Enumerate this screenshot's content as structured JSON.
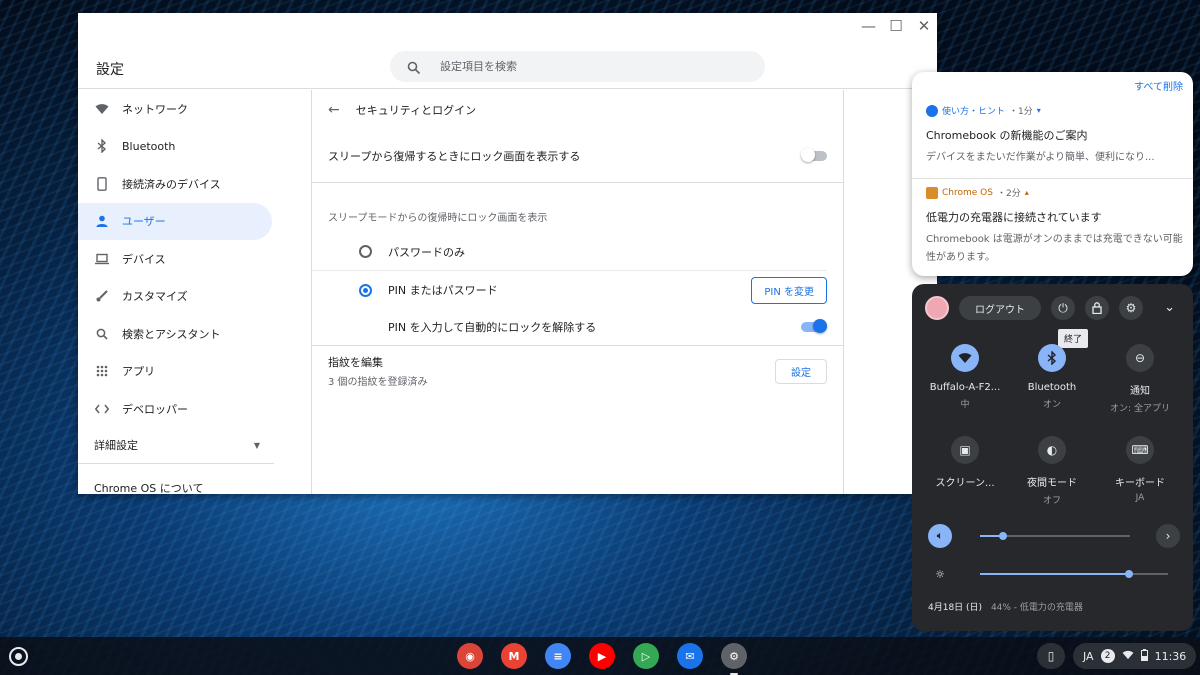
{
  "settings": {
    "app_title": "設定",
    "search_placeholder": "設定項目を検索",
    "window_controls": {
      "minimize_icon": "minimize-icon",
      "maximize_icon": "maximize-icon",
      "close_icon": "close-icon"
    },
    "sidebar": {
      "items": [
        {
          "label": "ネットワーク",
          "icon": "wifi-icon"
        },
        {
          "label": "Bluetooth",
          "icon": "bluetooth-icon"
        },
        {
          "label": "接続済みのデバイス",
          "icon": "phone-icon"
        },
        {
          "label": "ユーザー",
          "icon": "person-icon",
          "active": true
        },
        {
          "label": "デバイス",
          "icon": "laptop-icon"
        },
        {
          "label": "カスタマイズ",
          "icon": "brush-icon"
        },
        {
          "label": "検索とアシスタント",
          "icon": "search-icon"
        },
        {
          "label": "アプリ",
          "icon": "apps-grid-icon"
        },
        {
          "label": "デベロッパー",
          "icon": "code-icon"
        }
      ],
      "advanced_label": "詳細設定",
      "about_label": "Chrome OS について"
    },
    "page": {
      "title": "セキュリティとログイン",
      "sleep_lock_label": "スリープから復帰するときにロック画面を表示する",
      "sleep_lock_enabled": false,
      "lock_section_label": "スリープモードからの復帰時にロック画面を表示",
      "option_password": "パスワードのみ",
      "option_pin": "PIN またはパスワード",
      "selected_option": "PIN またはパスワード",
      "change_pin_button": "PIN を変更",
      "auto_unlock_label": "PIN を入力して自動的にロックを解除する",
      "auto_unlock_enabled": true,
      "fingerprint_title": "指紋を編集",
      "fingerprint_sub": "3 個の指紋を登録済み",
      "fingerprint_button": "設定"
    }
  },
  "notifications": {
    "clear_all": "すべて削除",
    "items": [
      {
        "app": "使い方・ヒント",
        "time": "・1分",
        "title": "Chromebook の新機能のご案内",
        "body": "デバイスをまたいだ作業がより簡単、便利になり..."
      },
      {
        "app": "Chrome OS",
        "time": "・2分",
        "title": "低電力の充電器に接続されています",
        "body": "Chromebook は電源がオンのままでは充電できない可能性があります。"
      }
    ]
  },
  "quick_settings": {
    "logout_label": "ログアウト",
    "tooltip": "終了",
    "tiles": [
      {
        "label": "Buffalo-A-F2...",
        "sub": "中",
        "icon": "wifi-icon",
        "on": true
      },
      {
        "label": "Bluetooth",
        "sub": "オン",
        "icon": "bluetooth-icon",
        "on": true
      },
      {
        "label": "通知",
        "sub": "オン: 全アプリ",
        "icon": "do-not-disturb-icon",
        "on": false
      },
      {
        "label": "スクリーン...",
        "sub": "",
        "icon": "screen-capture-icon",
        "on": false
      },
      {
        "label": "夜間モード",
        "sub": "オフ",
        "icon": "night-light-icon",
        "on": false
      },
      {
        "label": "キーボード",
        "sub": "JA",
        "icon": "keyboard-icon",
        "on": false
      }
    ],
    "volume_level": 0.15,
    "brightness_level": 0.79,
    "date": "4月18日 (日)",
    "battery": "44% - 低電力の充電器"
  },
  "shelf": {
    "apps": [
      {
        "name": "chrome",
        "color": "#db4437"
      },
      {
        "name": "gmail",
        "color": "#ea4335"
      },
      {
        "name": "docs",
        "color": "#4285f4"
      },
      {
        "name": "youtube",
        "color": "#ff0000"
      },
      {
        "name": "play-store",
        "color": "#34a853"
      },
      {
        "name": "messages",
        "color": "#1a73e8"
      },
      {
        "name": "settings",
        "color": "#5f6368",
        "active": true
      }
    ],
    "ime": "JA",
    "notification_count": "2",
    "time": "11:36"
  },
  "colors": {
    "accent": "#1a73e8",
    "qs_bg": "#26282c",
    "tile_on": "#8ab4f8"
  }
}
